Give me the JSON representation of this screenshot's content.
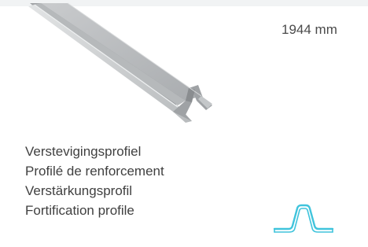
{
  "product": {
    "length": "1944 mm",
    "names": [
      "Verstevigingsprofiel",
      "Profilé de renforcement",
      "Verstärkungsprofil",
      "Fortification profile"
    ]
  },
  "icons": {
    "product_image": "steel-profile-photo",
    "cross_section": "omega-profile-cross-section-icon"
  },
  "colors": {
    "profile_outline": "#40c4dc",
    "metal_light": "#d4d6d8",
    "metal_dark": "#8e9194"
  }
}
